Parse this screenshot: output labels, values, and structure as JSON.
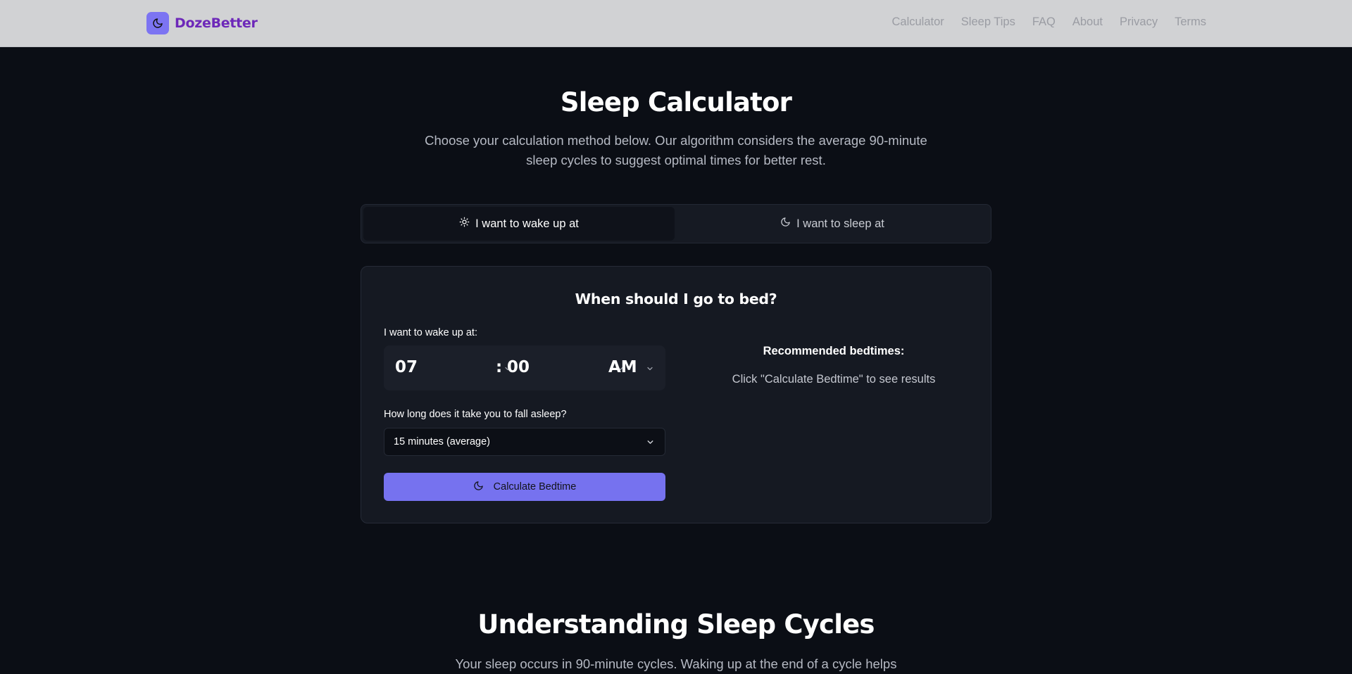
{
  "header": {
    "brand": "DozeBetter",
    "nav": [
      "Calculator",
      "Sleep Tips",
      "FAQ",
      "About",
      "Privacy",
      "Terms"
    ]
  },
  "hero": {
    "title": "Sleep Calculator",
    "subtitle": "Choose your calculation method below. Our algorithm considers the average 90-minute sleep cycles to suggest optimal times for better rest."
  },
  "tabs": {
    "wake_label": "I want to wake up at",
    "sleep_label": "I want to sleep at",
    "active": "wake"
  },
  "card": {
    "title": "When should I go to bed?",
    "wake_label": "I want to wake up at:",
    "time": {
      "hour": "07",
      "separator": ":",
      "minute": "00",
      "period": "AM"
    },
    "fall_asleep_label": "How long does it take you to fall asleep?",
    "fall_asleep_value": "15 minutes (average)",
    "calculate_label": "Calculate Bedtime",
    "results_title": "Recommended bedtimes:",
    "results_hint": "Click \"Calculate Bedtime\" to see results"
  },
  "section": {
    "title": "Understanding Sleep Cycles",
    "subtitle": "Your sleep occurs in 90-minute cycles. Waking up at the end of a cycle helps"
  },
  "colors": {
    "background": "#0b0e15",
    "accent": "#7672ef",
    "brand": "#6d28b9",
    "header": "#d1d2d4"
  },
  "icons": [
    "moon-icon",
    "sun-icon",
    "chevron-down-icon"
  ]
}
